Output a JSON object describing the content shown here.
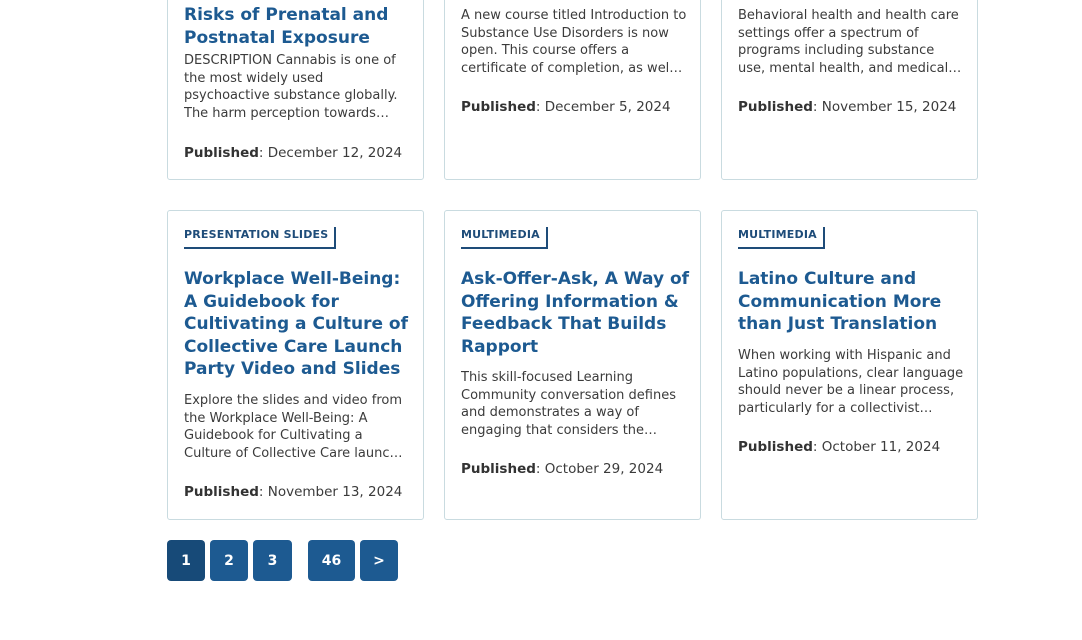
{
  "cards": [
    {
      "title": "Risks of Prenatal and Postnatal Exposure",
      "description": "DESCRIPTION Cannabis is one of the most widely used psychoactive substance globally. The harm perception towards cannabis use …",
      "published_label": "Published",
      "published_date": ": December 12, 2024"
    },
    {
      "description": "A new course titled Introduction to Substance Use Disorders is now open. This course offers a certificate of completion, as wel…",
      "published_label": "Published",
      "published_date": ": December 5, 2024"
    },
    {
      "description": "Behavioral health and health care settings offer a spectrum of programs including substance use, mental health, and medical and…",
      "published_label": "Published",
      "published_date": ": November 15, 2024"
    },
    {
      "badge": "PRESENTATION SLIDES",
      "title": "Workplace Well-Being: A Guidebook for Cultivating a Culture of Collective Care Launch Party Video and Slides",
      "description": "Explore the slides and video from the Workplace Well-Being: A Guidebook for Cultivating a Culture of Collective Care launch event…",
      "published_label": "Published",
      "published_date": ": November 13, 2024"
    },
    {
      "badge": "MULTIMEDIA",
      "title": "Ask-Offer-Ask, A Way of Offering Information & Feedback That Builds Rapport",
      "description": "This skill-focused Learning Community conversation defines and demonstrates a way of engaging that considers the…",
      "published_label": "Published",
      "published_date": ": October 29, 2024"
    },
    {
      "badge": "MULTIMEDIA",
      "title": "Latino Culture and Communication More than Just Translation",
      "description": "When working with Hispanic and Latino populations, clear language should never be a linear process, particularly for a collectivist socie…",
      "published_label": "Published",
      "published_date": ": October 11, 2024"
    }
  ],
  "pagination": {
    "pages": [
      "1",
      "2",
      "3",
      "46"
    ],
    "current": "1",
    "next_label": ">"
  },
  "colors": {
    "accent": "#1d5a91",
    "border": "#c9dbe0"
  }
}
